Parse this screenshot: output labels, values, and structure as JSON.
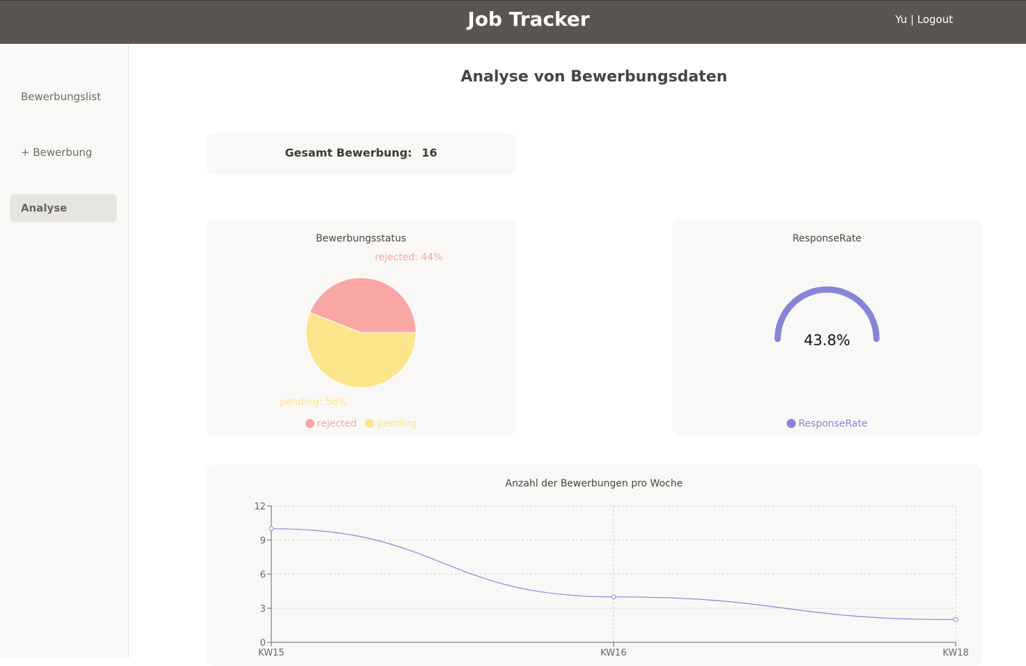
{
  "header": {
    "app_title": "Job Tracker",
    "user_name": "Yu",
    "separator": " | ",
    "logout_label": "Logout"
  },
  "sidebar": {
    "items": [
      {
        "label": "Bewerbungslist",
        "active": false
      },
      {
        "label": "+ Bewerbung",
        "active": false
      },
      {
        "label": "Analyse",
        "active": true
      }
    ]
  },
  "main": {
    "page_title": "Analyse von Bewerbungsdaten",
    "total": {
      "label": "Gesamt Bewerbung:",
      "value": "16"
    }
  },
  "colors": {
    "rejected": "#f8a7a4",
    "pending": "#fde58c",
    "response": "#8884d8",
    "grid": "#d0d0d0",
    "axis": "#666666"
  },
  "chart_data": [
    {
      "type": "pie",
      "title": "Bewerbungsstatus",
      "slices": [
        {
          "name": "rejected",
          "value": 44,
          "label": "rejected: 44%"
        },
        {
          "name": "pending",
          "value": 56,
          "label": "pending: 56%"
        }
      ],
      "legend": [
        "rejected",
        "pending"
      ],
      "legend_position": "bottom-center"
    },
    {
      "type": "gauge",
      "title": "ResponseRate",
      "value": 43.8,
      "value_label": "43.8%",
      "legend": [
        "ResponseRate"
      ],
      "legend_position": "bottom-center"
    },
    {
      "type": "line",
      "title": "Anzahl der Bewerbungen pro Woche",
      "categories": [
        "KW15",
        "KW16",
        "KW18"
      ],
      "series": [
        {
          "values": [
            10,
            4,
            2
          ]
        }
      ],
      "ylim": [
        0,
        12
      ],
      "yticks": [
        "0",
        "3",
        "6",
        "9",
        "12"
      ],
      "grid": true
    }
  ]
}
